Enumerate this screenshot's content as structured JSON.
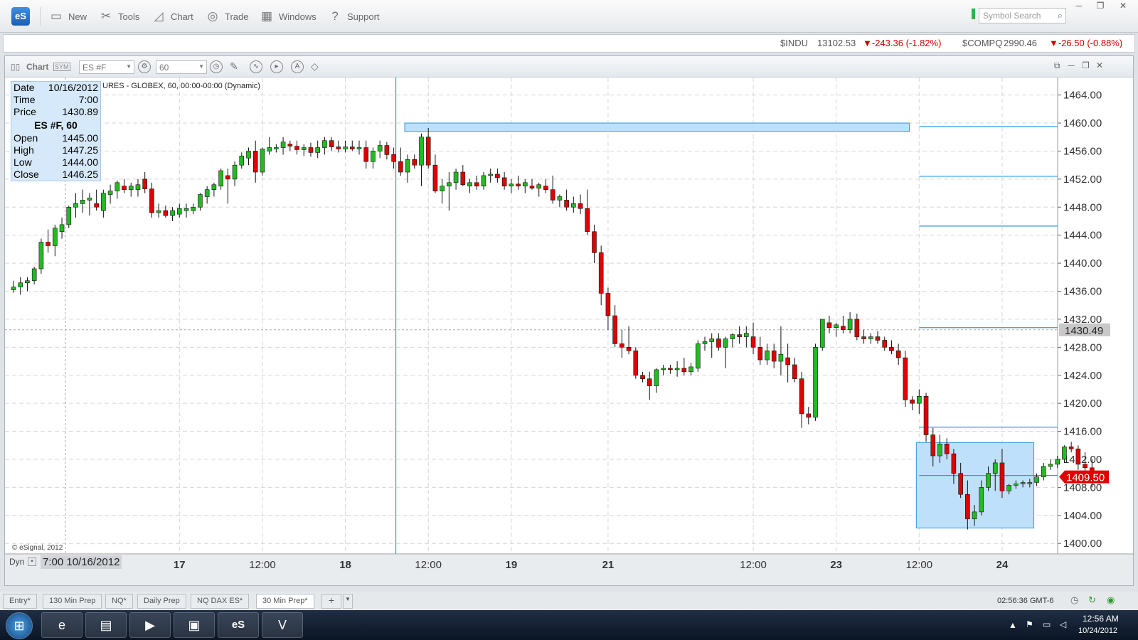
{
  "app": {
    "logo": "eS",
    "toolbar": [
      {
        "label": "New",
        "icon": "new-chart-icon"
      },
      {
        "label": "Tools",
        "icon": "tools-icon"
      },
      {
        "label": "Chart",
        "icon": "chart-icon"
      },
      {
        "label": "Trade",
        "icon": "trade-icon"
      },
      {
        "label": "Windows",
        "icon": "windows-icon"
      },
      {
        "label": "Support",
        "icon": "support-icon"
      }
    ],
    "symbol_search_placeholder": "Symbol Search"
  },
  "ticker": [
    {
      "symbol": "$INDU",
      "last": "13102.53",
      "change": "▼-243.36 (-1.82%)"
    },
    {
      "symbol": "$COMPQ",
      "last": "2990.46",
      "change": "▼-26.50 (-0.88%)"
    }
  ],
  "chart_window": {
    "title": "Chart",
    "symbol": "ES #F",
    "interval": "60",
    "study_title": "URES - GLOBEX, 60, 00:00-00:00 (Dynamic)",
    "copyright": "© eSignal, 2012",
    "dyn_label": "Dyn",
    "cursor_time_label": "7:00 10/16/2012"
  },
  "infobox": {
    "rows_top": [
      {
        "k": "Date",
        "v": "10/16/2012"
      },
      {
        "k": "Time",
        "v": "7:00"
      },
      {
        "k": "Price",
        "v": "1430.89"
      }
    ],
    "header": "ES #F, 60",
    "rows_bottom": [
      {
        "k": "Open",
        "v": "1445.00"
      },
      {
        "k": "High",
        "v": "1447.25"
      },
      {
        "k": "Low",
        "v": "1444.00"
      },
      {
        "k": "Close",
        "v": "1446.25"
      }
    ]
  },
  "chart_data": {
    "type": "candlestick",
    "ylim": [
      1398.5,
      1466.5
    ],
    "y_ticks": [
      "1464.00",
      "1460.00",
      "1456.00",
      "1452.00",
      "1448.00",
      "1444.00",
      "1440.00",
      "1436.00",
      "1432.00",
      "1428.00",
      "1424.00",
      "1420.00",
      "1416.00",
      "1412.00",
      "1408.00",
      "1404.00",
      "1400.00"
    ],
    "x_labels": [
      {
        "label": "17",
        "bar": 24
      },
      {
        "label": "12:00",
        "bar": 36
      },
      {
        "label": "18",
        "bar": 48
      },
      {
        "label": "12:00",
        "bar": 60
      },
      {
        "label": "19",
        "bar": 72
      },
      {
        "label": "21",
        "bar": 86
      },
      {
        "label": "12:00",
        "bar": 107
      },
      {
        "label": "23",
        "bar": 119
      },
      {
        "label": "12:00",
        "bar": 131
      },
      {
        "label": "24",
        "bar": 143
      }
    ],
    "crosshair_price": "1430.49",
    "last_price": "1409.50",
    "levels": [
      1459.5,
      1452.4,
      1445.3,
      1430.8,
      1416.6,
      1409.7
    ],
    "zones": [
      {
        "x1": 57,
        "x2": 130,
        "high": 1460.0,
        "low": 1458.8
      },
      {
        "x1": 131,
        "x2": 148,
        "high": 1414.4,
        "low": 1402.2
      }
    ],
    "candles": [
      [
        1436.2,
        1437.5,
        1435.8,
        1436.6
      ],
      [
        1436.6,
        1438.0,
        1435.5,
        1437.2
      ],
      [
        1437.2,
        1438.0,
        1436.0,
        1437.5
      ],
      [
        1437.5,
        1439.5,
        1437.0,
        1439.2
      ],
      [
        1439.2,
        1443.5,
        1438.5,
        1443.0
      ],
      [
        1443.0,
        1444.8,
        1441.5,
        1442.5
      ],
      [
        1442.5,
        1445.5,
        1441.0,
        1445.0
      ],
      [
        1444.5,
        1446.5,
        1443.5,
        1445.5
      ],
      [
        1445.5,
        1448.2,
        1445.0,
        1448.0
      ],
      [
        1448.0,
        1450.0,
        1446.5,
        1448.5
      ],
      [
        1448.5,
        1450.5,
        1447.2,
        1449.0
      ],
      [
        1449.0,
        1450.0,
        1446.8,
        1449.3
      ],
      [
        1448.5,
        1450.5,
        1447.5,
        1448.0
      ],
      [
        1447.5,
        1450.5,
        1446.5,
        1450.0
      ],
      [
        1449.8,
        1451.2,
        1448.5,
        1450.3
      ],
      [
        1450.3,
        1451.8,
        1449.2,
        1451.5
      ],
      [
        1451.0,
        1452.0,
        1450.0,
        1450.5
      ],
      [
        1450.5,
        1451.5,
        1449.5,
        1451.0
      ],
      [
        1450.5,
        1452.0,
        1449.5,
        1451.2
      ],
      [
        1452.0,
        1453.0,
        1450.0,
        1450.6
      ],
      [
        1450.6,
        1451.5,
        1446.5,
        1447.2
      ],
      [
        1447.2,
        1448.5,
        1446.5,
        1447.5
      ],
      [
        1447.5,
        1448.2,
        1446.5,
        1446.8
      ],
      [
        1446.8,
        1448.0,
        1446.0,
        1447.5
      ],
      [
        1447.0,
        1448.5,
        1446.5,
        1447.8
      ],
      [
        1447.5,
        1448.5,
        1446.5,
        1447.8
      ],
      [
        1447.5,
        1448.5,
        1447.0,
        1448.0
      ],
      [
        1448.0,
        1450.0,
        1447.5,
        1449.8
      ],
      [
        1449.5,
        1451.0,
        1448.5,
        1450.5
      ],
      [
        1450.5,
        1451.5,
        1449.5,
        1451.2
      ],
      [
        1451.0,
        1453.5,
        1450.5,
        1453.2
      ],
      [
        1452.5,
        1453.5,
        1448.5,
        1452.0
      ],
      [
        1452.0,
        1454.5,
        1451.0,
        1454.0
      ],
      [
        1454.0,
        1455.8,
        1453.5,
        1455.3
      ],
      [
        1455.0,
        1456.5,
        1454.0,
        1456.0
      ],
      [
        1456.0,
        1457.5,
        1451.5,
        1453.0
      ],
      [
        1453.0,
        1456.5,
        1452.5,
        1456.3
      ],
      [
        1456.0,
        1458.0,
        1455.5,
        1456.5
      ],
      [
        1456.3,
        1457.0,
        1455.8,
        1456.5
      ],
      [
        1456.5,
        1458.0,
        1455.5,
        1457.3
      ],
      [
        1457.0,
        1457.5,
        1456.0,
        1456.7
      ],
      [
        1456.7,
        1457.5,
        1455.5,
        1456.2
      ],
      [
        1456.2,
        1457.0,
        1455.3,
        1456.5
      ],
      [
        1456.5,
        1457.2,
        1455.2,
        1455.8
      ],
      [
        1455.8,
        1457.5,
        1455.0,
        1456.5
      ],
      [
        1456.5,
        1458.0,
        1455.5,
        1457.5
      ],
      [
        1457.5,
        1458.0,
        1456.0,
        1456.6
      ],
      [
        1456.6,
        1457.5,
        1455.8,
        1456.3
      ],
      [
        1456.3,
        1457.5,
        1455.8,
        1456.6
      ],
      [
        1456.6,
        1457.5,
        1456.0,
        1456.3
      ],
      [
        1456.3,
        1457.5,
        1455.5,
        1456.5
      ],
      [
        1456.5,
        1457.5,
        1453.5,
        1454.5
      ],
      [
        1454.5,
        1456.5,
        1453.5,
        1456.0
      ],
      [
        1456.0,
        1457.5,
        1455.0,
        1456.8
      ],
      [
        1456.8,
        1457.3,
        1454.8,
        1455.5
      ],
      [
        1455.5,
        1456.5,
        1453.5,
        1454.5
      ],
      [
        1454.5,
        1456.5,
        1452.5,
        1453.0
      ],
      [
        1453.0,
        1455.5,
        1451.5,
        1454.8
      ],
      [
        1454.8,
        1455.5,
        1453.5,
        1454.0
      ],
      [
        1454.0,
        1458.5,
        1451.0,
        1458.0
      ],
      [
        1458.0,
        1459.3,
        1453.5,
        1454.0
      ],
      [
        1454.0,
        1455.5,
        1450.0,
        1450.3
      ],
      [
        1450.3,
        1452.0,
        1448.5,
        1451.0
      ],
      [
        1451.0,
        1453.0,
        1447.5,
        1451.5
      ],
      [
        1451.5,
        1453.5,
        1450.5,
        1453.0
      ],
      [
        1453.0,
        1454.0,
        1451.0,
        1451.2
      ],
      [
        1451.0,
        1452.0,
        1450.0,
        1451.5
      ],
      [
        1451.5,
        1452.5,
        1450.5,
        1451.0
      ],
      [
        1451.0,
        1453.0,
        1450.5,
        1452.5
      ],
      [
        1452.5,
        1453.5,
        1451.5,
        1452.7
      ],
      [
        1452.7,
        1453.5,
        1451.5,
        1452.2
      ],
      [
        1452.2,
        1453.0,
        1450.5,
        1451.0
      ],
      [
        1451.0,
        1452.0,
        1450.0,
        1451.3
      ],
      [
        1451.3,
        1452.5,
        1450.5,
        1451.0
      ],
      [
        1451.0,
        1452.0,
        1450.0,
        1451.5
      ],
      [
        1451.0,
        1452.0,
        1450.5,
        1450.7
      ],
      [
        1450.7,
        1451.5,
        1449.5,
        1451.2
      ],
      [
        1451.0,
        1452.0,
        1450.0,
        1450.5
      ],
      [
        1450.5,
        1452.5,
        1448.5,
        1449.0
      ],
      [
        1449.0,
        1449.8,
        1448.0,
        1449.5
      ],
      [
        1449.0,
        1450.5,
        1447.5,
        1448.0
      ],
      [
        1448.0,
        1449.5,
        1447.2,
        1448.5
      ],
      [
        1448.5,
        1449.8,
        1447.0,
        1447.8
      ],
      [
        1447.8,
        1450.5,
        1444.0,
        1444.5
      ],
      [
        1444.5,
        1445.5,
        1440.0,
        1441.5
      ],
      [
        1441.5,
        1442.5,
        1434.0,
        1435.7
      ],
      [
        1435.7,
        1436.5,
        1430.5,
        1432.5
      ],
      [
        1432.5,
        1434.0,
        1428.0,
        1428.5
      ],
      [
        1428.5,
        1430.5,
        1426.5,
        1428.0
      ],
      [
        1428.0,
        1431.0,
        1427.0,
        1427.5
      ],
      [
        1427.5,
        1428.0,
        1423.5,
        1424.0
      ],
      [
        1424.0,
        1424.5,
        1423.0,
        1423.5
      ],
      [
        1423.5,
        1424.5,
        1420.5,
        1422.5
      ],
      [
        1422.5,
        1425.0,
        1421.5,
        1424.8
      ],
      [
        1424.8,
        1425.5,
        1424.0,
        1425.0
      ],
      [
        1425.0,
        1425.5,
        1424.2,
        1424.8
      ],
      [
        1424.8,
        1426.0,
        1423.8,
        1425.0
      ],
      [
        1425.0,
        1426.5,
        1424.0,
        1424.5
      ],
      [
        1424.5,
        1425.8,
        1424.0,
        1425.2
      ],
      [
        1425.0,
        1429.0,
        1424.5,
        1428.5
      ],
      [
        1428.5,
        1429.5,
        1427.5,
        1428.8
      ],
      [
        1428.8,
        1430.0,
        1426.5,
        1429.2
      ],
      [
        1429.2,
        1430.0,
        1427.5,
        1428.0
      ],
      [
        1428.0,
        1429.5,
        1425.0,
        1429.2
      ],
      [
        1429.2,
        1430.0,
        1428.0,
        1429.8
      ],
      [
        1429.8,
        1431.0,
        1428.5,
        1429.5
      ],
      [
        1429.5,
        1431.0,
        1428.0,
        1430.0
      ],
      [
        1429.5,
        1431.5,
        1427.0,
        1428.0
      ],
      [
        1428.0,
        1429.5,
        1425.5,
        1426.2
      ],
      [
        1426.2,
        1428.5,
        1425.5,
        1427.5
      ],
      [
        1427.5,
        1428.5,
        1425.0,
        1426.0
      ],
      [
        1426.0,
        1431.0,
        1424.0,
        1427.0
      ],
      [
        1426.5,
        1428.5,
        1423.0,
        1425.5
      ],
      [
        1425.5,
        1426.5,
        1423.0,
        1423.5
      ],
      [
        1423.5,
        1424.5,
        1416.5,
        1418.5
      ],
      [
        1418.5,
        1419.5,
        1417.0,
        1418.0
      ],
      [
        1418.0,
        1428.5,
        1417.5,
        1428.0
      ],
      [
        1428.0,
        1432.0,
        1427.5,
        1432.0
      ],
      [
        1431.5,
        1432.5,
        1430.0,
        1430.8
      ],
      [
        1430.8,
        1431.5,
        1429.5,
        1431.2
      ],
      [
        1431.0,
        1432.5,
        1430.0,
        1430.5
      ],
      [
        1430.5,
        1433.0,
        1430.0,
        1432.0
      ],
      [
        1432.0,
        1432.8,
        1429.0,
        1429.5
      ],
      [
        1429.5,
        1430.5,
        1428.5,
        1429.2
      ],
      [
        1429.2,
        1430.0,
        1428.5,
        1429.5
      ],
      [
        1429.5,
        1430.3,
        1428.5,
        1429.0
      ],
      [
        1429.0,
        1429.5,
        1427.5,
        1428.0
      ],
      [
        1428.0,
        1429.0,
        1427.0,
        1427.5
      ],
      [
        1427.5,
        1428.5,
        1425.5,
        1426.5
      ],
      [
        1426.5,
        1427.5,
        1419.5,
        1420.5
      ],
      [
        1420.5,
        1421.0,
        1419.0,
        1420.0
      ],
      [
        1420.0,
        1422.0,
        1418.5,
        1421.0
      ],
      [
        1421.0,
        1421.5,
        1414.5,
        1415.5
      ],
      [
        1415.5,
        1416.5,
        1411.0,
        1412.5
      ],
      [
        1412.5,
        1415.5,
        1411.5,
        1414.2
      ],
      [
        1414.2,
        1415.0,
        1412.0,
        1412.8
      ],
      [
        1412.8,
        1413.5,
        1408.5,
        1410.0
      ],
      [
        1410.0,
        1411.5,
        1406.5,
        1407.0
      ],
      [
        1407.0,
        1409.0,
        1402.0,
        1403.5
      ],
      [
        1403.5,
        1405.5,
        1402.5,
        1404.5
      ],
      [
        1404.5,
        1409.0,
        1404.0,
        1408.0
      ],
      [
        1408.0,
        1411.0,
        1407.5,
        1410.0
      ],
      [
        1410.0,
        1412.0,
        1407.5,
        1411.5
      ],
      [
        1411.5,
        1413.5,
        1406.5,
        1407.5
      ],
      [
        1407.5,
        1408.5,
        1407.0,
        1408.3
      ],
      [
        1408.3,
        1409.0,
        1407.8,
        1408.5
      ],
      [
        1408.5,
        1409.0,
        1408.0,
        1408.7
      ],
      [
        1408.5,
        1409.2,
        1408.0,
        1408.7
      ],
      [
        1408.7,
        1410.0,
        1408.2,
        1409.5
      ],
      [
        1409.5,
        1411.5,
        1409.0,
        1411.0
      ],
      [
        1411.0,
        1412.0,
        1410.5,
        1411.3
      ],
      [
        1411.3,
        1412.5,
        1410.8,
        1412.0
      ],
      [
        1412.0,
        1414.0,
        1411.5,
        1413.8
      ],
      [
        1413.8,
        1414.5,
        1413.0,
        1413.5
      ],
      [
        1413.5,
        1414.0,
        1410.5,
        1411.3
      ],
      [
        1411.3,
        1413.0,
        1410.0,
        1410.8
      ],
      [
        1410.8,
        1412.0,
        1408.0,
        1409.5
      ]
    ]
  },
  "chart_colors": {
    "up": "#22bb22",
    "down": "#e00000",
    "level": "#2a9be0",
    "zone": "#bfe0fa",
    "grid": "#d6d6d6"
  },
  "bottom_tabs": [
    "Entry*",
    "130 Min Prep",
    "NQ*",
    "Daily Prep",
    "NQ DAX ES*",
    "30 Min Prep*"
  ],
  "active_tab": "30 Min Prep*",
  "status_clock": "02:56:36 GMT-6",
  "taskbar": {
    "time": "12:56 AM",
    "date": "10/24/2012"
  }
}
